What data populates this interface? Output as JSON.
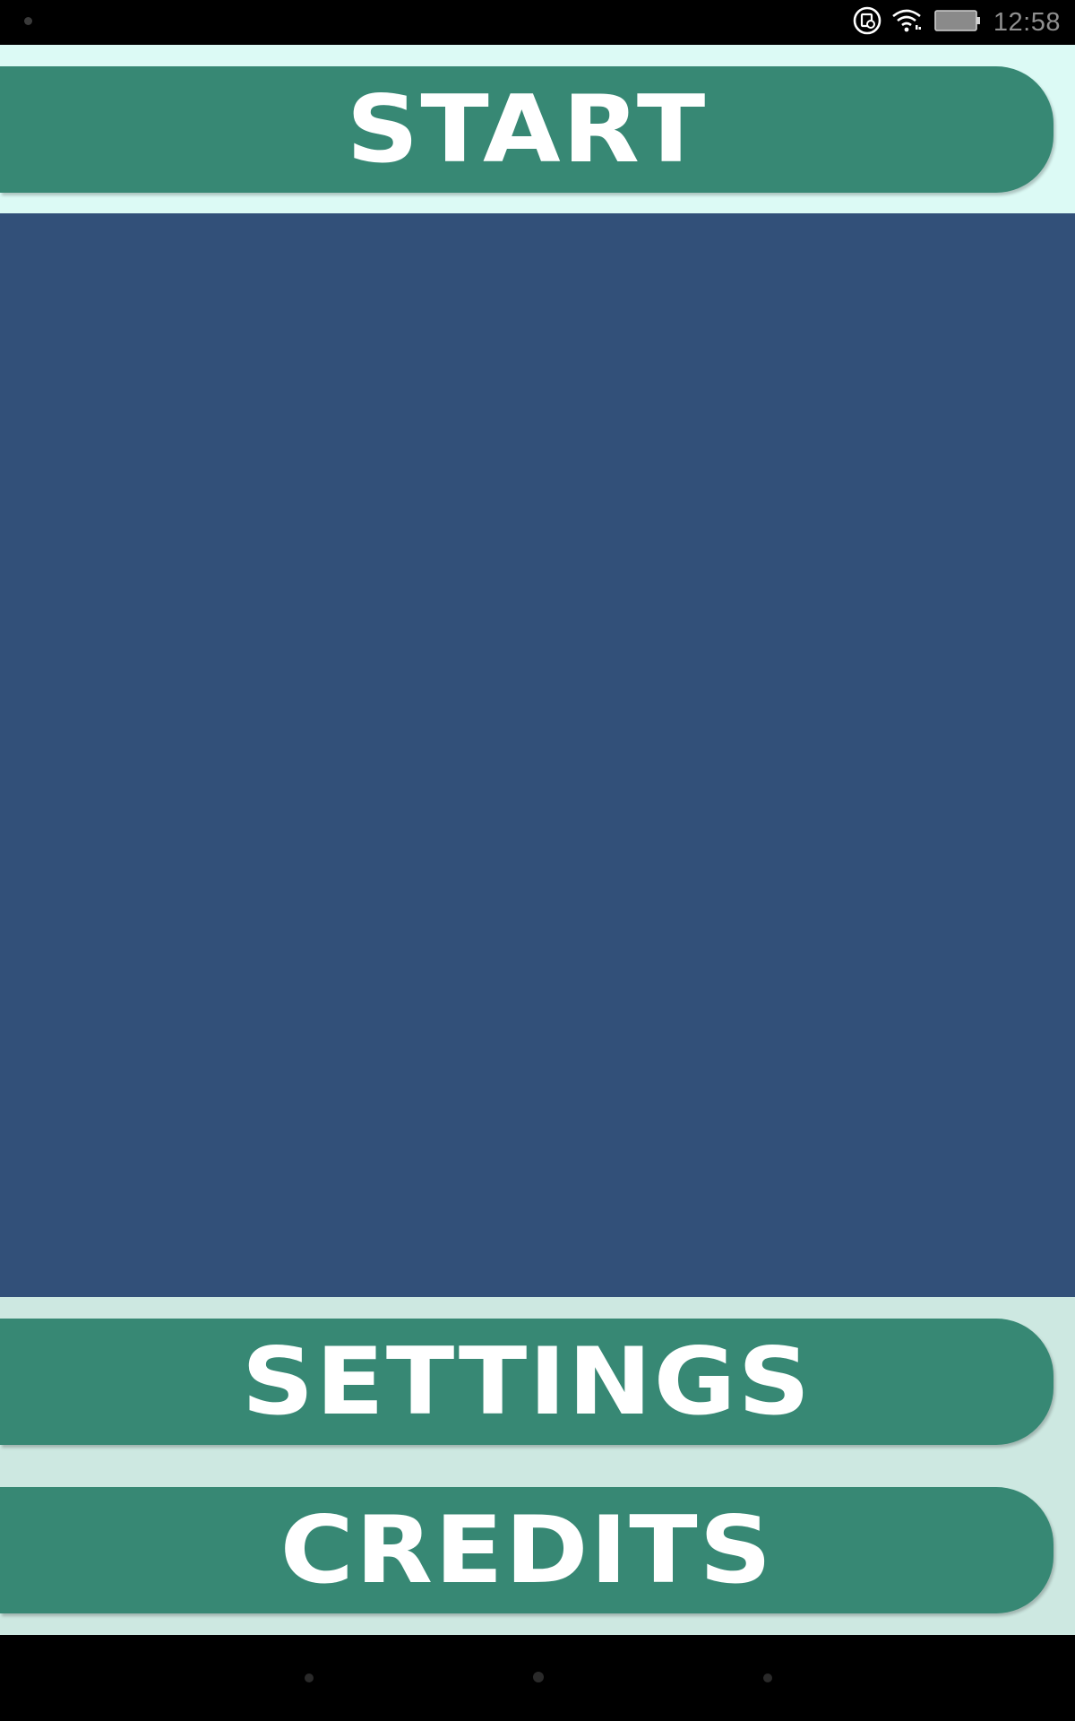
{
  "status_bar": {
    "time": "12:58",
    "icons": [
      "screen-record-icon",
      "wifi-icon",
      "battery-icon"
    ]
  },
  "menu": {
    "start_label": "START",
    "settings_label": "SETTINGS",
    "credits_label": "CREDITS"
  },
  "nav_bar": {
    "icons": [
      "back-icon",
      "home-icon",
      "recents-icon"
    ]
  },
  "colors": {
    "button": "#378874",
    "top_band": "#dcfaf5",
    "bottom_band": "#cde8e1",
    "panel": "#325079",
    "label": "#ffffff"
  }
}
